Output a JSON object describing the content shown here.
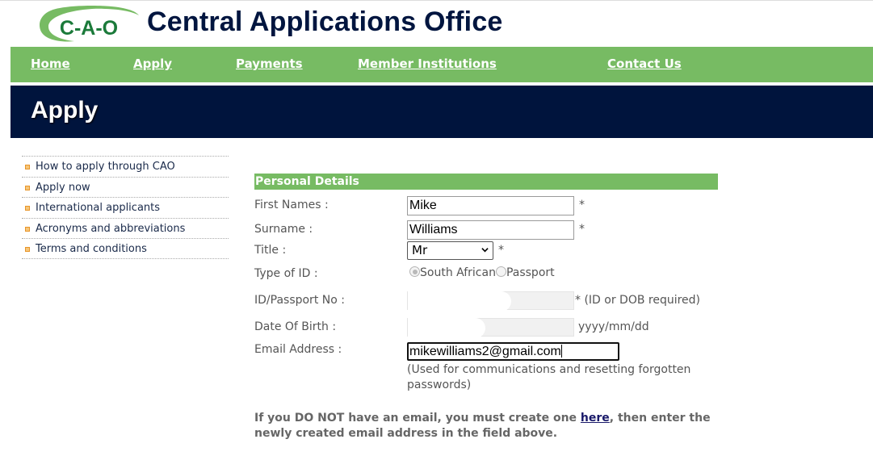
{
  "header": {
    "logo_text": "C-A-O",
    "site_title": "Central Applications Office"
  },
  "nav": {
    "items": [
      "Home",
      "Apply",
      "Payments",
      "Member Institutions",
      "Contact Us"
    ]
  },
  "banner": {
    "title": "Apply"
  },
  "sidebar": {
    "items": [
      "How to apply through CAO",
      "Apply now",
      "International applicants",
      "Acronyms and abbreviations",
      "Terms and conditions"
    ]
  },
  "form": {
    "section_title": "Personal Details",
    "first_names": {
      "label": "First Names :",
      "value": "Mike",
      "required": "*"
    },
    "surname": {
      "label": "Surname :",
      "value": "Williams",
      "required": "*"
    },
    "title": {
      "label": "Title :",
      "value": "Mr",
      "required": "*"
    },
    "id_type": {
      "label": "Type of ID :",
      "options": [
        "South African",
        "Passport"
      ],
      "selected": "South African"
    },
    "id_number": {
      "label": "ID/Passport No :",
      "hint": "* (ID or DOB required)"
    },
    "dob": {
      "label": "Date Of Birth :",
      "hint": "yyyy/mm/dd"
    },
    "email": {
      "label": "Email Address :",
      "value": "mikewilliams2@gmail.com",
      "note": "(Used for communications and resetting forgotten passwords)"
    },
    "bottom_note": {
      "before": "If you DO NOT have an email, you must create one ",
      "link": "here",
      "after": ", then enter the newly created email address in the field above."
    }
  },
  "colors": {
    "nav_green": "#77bb63",
    "banner_navy": "#00143d",
    "title_navy": "#00153f",
    "bullet_orange": "#e8952a"
  }
}
